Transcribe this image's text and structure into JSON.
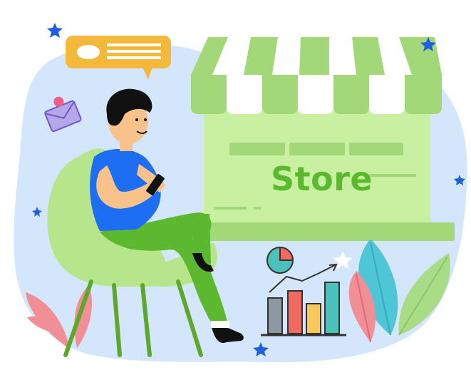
{
  "store": {
    "label": "Store"
  },
  "colors": {
    "blob": "#d3e6fb",
    "awning_green": "#a3d878",
    "awning_white": "#ffffff",
    "store_body": "#c7f1a0",
    "store_ledge": "#a3d878",
    "store_text": "#5cb82e",
    "chair": "#b6e58c",
    "chair_legs": "#5da82a",
    "shirt": "#1d6ef2",
    "pants": "#5cb82e",
    "skin": "#f9c28a",
    "hair": "#111111",
    "speech_bubble": "#f4b93a",
    "star": "#1f5fe0",
    "leaf_pink": "#f08f95",
    "leaf_teal": "#4fc6d6",
    "leaf_green": "#a8dc86",
    "chart_bars": [
      "#8f97a3",
      "#f16a5f",
      "#f7c85a",
      "#4bc1bc"
    ]
  },
  "icons": [
    "speech-bubble-icon",
    "email-icon",
    "pie-chart-icon",
    "bar-chart-icon",
    "star-icon",
    "leaf-icon"
  ]
}
